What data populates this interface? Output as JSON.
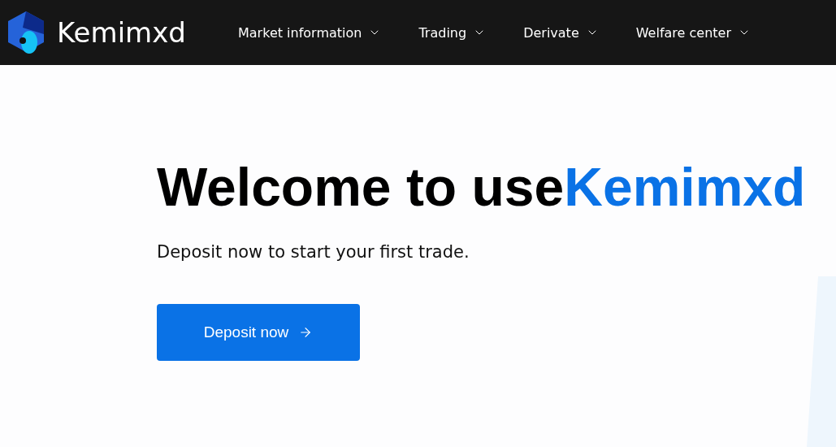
{
  "brand": {
    "name": "Kemimxd"
  },
  "nav": [
    {
      "label": "Market information"
    },
    {
      "label": "Trading"
    },
    {
      "label": "Derivate"
    },
    {
      "label": "Welfare center"
    }
  ],
  "hero": {
    "title": "Welcome to use",
    "title_highlight": "Kemimxd",
    "subtitle": "Deposit now to start your first trade.",
    "button": "Deposit now"
  }
}
